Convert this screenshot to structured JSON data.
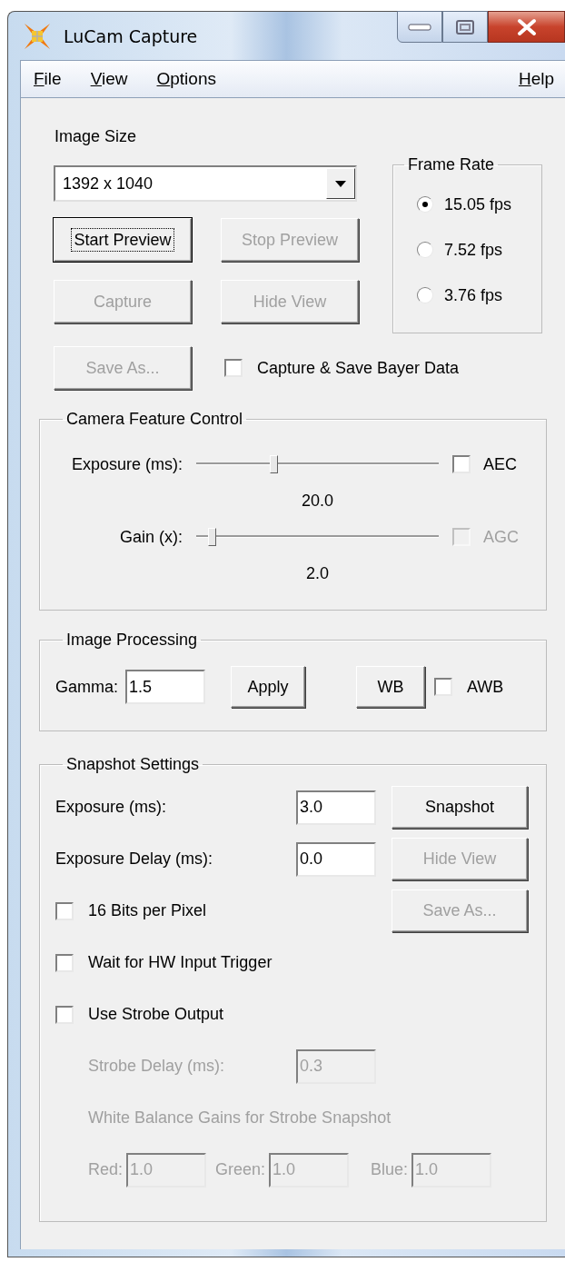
{
  "window": {
    "title": "LuCam Capture"
  },
  "menu": {
    "left": [
      {
        "access_key": "F",
        "rest": "ile"
      },
      {
        "access_key": "V",
        "rest": "iew"
      },
      {
        "access_key": "O",
        "rest": "ptions"
      }
    ],
    "right": [
      {
        "access_key": "H",
        "rest": "elp"
      }
    ]
  },
  "image_size": {
    "label": "Image Size",
    "value": "1392 x 1040"
  },
  "frame_rate": {
    "title": "Frame Rate",
    "options": [
      {
        "label": "15.05 fps",
        "selected": true
      },
      {
        "label": "7.52 fps",
        "selected": false
      },
      {
        "label": "3.76 fps",
        "selected": false
      }
    ]
  },
  "preview_buttons": [
    {
      "label": "Start Preview",
      "disabled": false,
      "focused": true
    },
    {
      "label": "Stop Preview",
      "disabled": true,
      "focused": false
    },
    {
      "label": "Capture",
      "disabled": true,
      "focused": false
    },
    {
      "label": "Hide View",
      "disabled": true,
      "focused": false
    },
    {
      "label": "Save As...",
      "disabled": true,
      "focused": false
    }
  ],
  "bayer": {
    "label": "Capture & Save Bayer Data",
    "checked": false,
    "disabled": false
  },
  "camera_feature_control": {
    "title": "Camera Feature Control",
    "sliders": [
      {
        "label": "Exposure (ms):",
        "level": 0.32,
        "reading": "20.0",
        "auto": {
          "label": "AEC",
          "checked": false,
          "disabled": false
        }
      },
      {
        "label": "Gain (x):",
        "level": 0.065,
        "reading": "2.0",
        "auto": {
          "label": "AGC",
          "checked": false,
          "disabled": true
        }
      }
    ]
  },
  "image_processing": {
    "title": "Image Processing",
    "gamma": {
      "label": "Gamma:",
      "value": "1.5"
    },
    "apply_button": {
      "label": "Apply"
    },
    "wb_button": {
      "label": "WB"
    },
    "awb": {
      "label": "AWB",
      "checked": false,
      "disabled": false
    }
  },
  "snapshot_settings": {
    "title": "Snapshot Settings",
    "fields": [
      {
        "label": "Exposure (ms):",
        "value": "3.0",
        "disabled": false
      },
      {
        "label": "Exposure Delay (ms):",
        "value": "0.0",
        "disabled": false
      }
    ],
    "buttons": [
      {
        "label": "Snapshot",
        "disabled": false
      },
      {
        "label": "Hide View",
        "disabled": true
      },
      {
        "label": "Save As...",
        "disabled": true
      }
    ],
    "options": [
      {
        "label": "16 Bits per Pixel",
        "checked": false,
        "disabled": false
      },
      {
        "label": "Wait for HW Input Trigger",
        "checked": false,
        "disabled": false
      },
      {
        "label": "Use Strobe Output",
        "checked": false,
        "disabled": false
      }
    ],
    "strobe_delay": {
      "label": "Strobe Delay (ms):",
      "value": "0.3",
      "disabled": true
    },
    "wb_gains_title": {
      "text": "White Balance Gains for Strobe Snapshot",
      "disabled": true
    },
    "wb_gains": [
      {
        "label": "Red:",
        "value": "1.0",
        "disabled": true
      },
      {
        "label": "Green:",
        "value": "1.0",
        "disabled": true
      },
      {
        "label": "Blue:",
        "value": "1.0",
        "disabled": true
      }
    ]
  }
}
